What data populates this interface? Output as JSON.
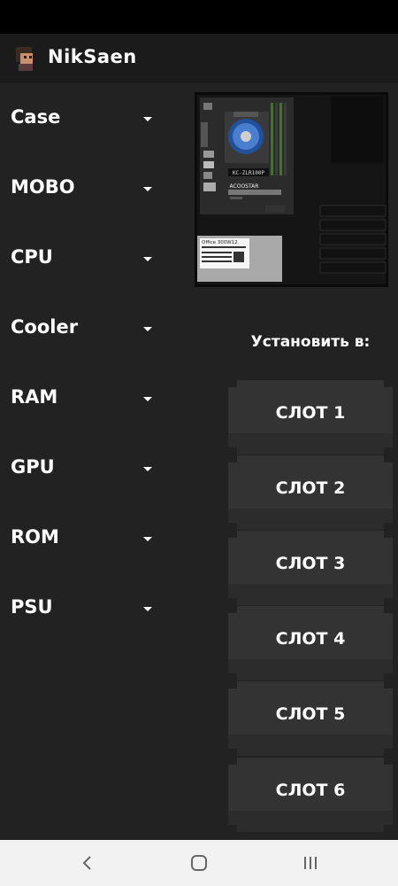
{
  "header": {
    "username": "NikSaen"
  },
  "menu": {
    "items": [
      {
        "label": "Case"
      },
      {
        "label": "MOBO"
      },
      {
        "label": "CPU"
      },
      {
        "label": "Cooler"
      },
      {
        "label": "RAM"
      },
      {
        "label": "GPU"
      },
      {
        "label": "ROM"
      },
      {
        "label": "PSU"
      }
    ]
  },
  "preview": {
    "cooler_text": "KC-ZLR100P",
    "board_brand": "ACOOSTAR",
    "psu_label": "Office 300W12"
  },
  "install": {
    "title": "Установить в:",
    "slots": [
      {
        "label": "СЛОТ 1"
      },
      {
        "label": "СЛОТ 2"
      },
      {
        "label": "СЛОТ 3"
      },
      {
        "label": "СЛОТ 4"
      },
      {
        "label": "СЛОТ 5"
      },
      {
        "label": "СЛОТ 6"
      }
    ]
  },
  "colors": {
    "background": "#222222",
    "header": "#1b1b1b",
    "button": "#333333",
    "nav_bar": "#f2f2f2"
  }
}
